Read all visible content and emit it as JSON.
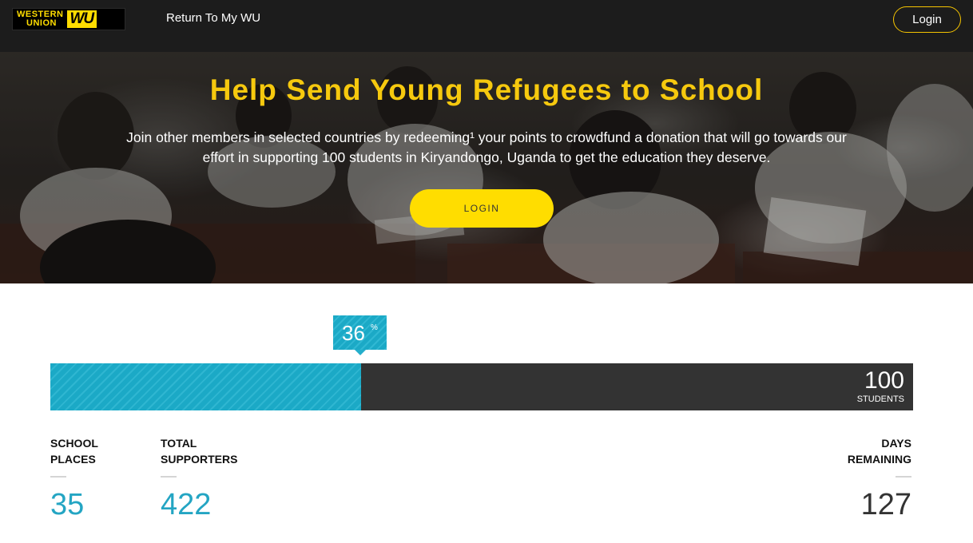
{
  "header": {
    "logo_words": [
      "WESTERN",
      "UNION"
    ],
    "logo_mark": "WU",
    "return_link": "Return To My WU",
    "login_button": "Login"
  },
  "hero": {
    "title": "Help Send Young Refugees to School",
    "text": "Join other members in selected countries by redeeming¹ your points to crowdfund a donation that will go towards our effort in supporting 100 students in Kiryandongo, Uganda to get the education they deserve.",
    "login_button": "LOGIN"
  },
  "progress": {
    "percent": 36,
    "percent_unit": "%",
    "goal": "100",
    "goal_unit": "STUDENTS",
    "fill_color": "#1ba9c6",
    "track_color": "#333333"
  },
  "stats": {
    "school_places": {
      "label_line1": "SCHOOL",
      "label_line2": "PLACES",
      "value": "35"
    },
    "total_supporters": {
      "label_line1": "TOTAL",
      "label_line2": "SUPPORTERS",
      "value": "422"
    },
    "days_remaining": {
      "label_line1": "DAYS",
      "label_line2": "REMAINING",
      "value": "127"
    }
  },
  "colors": {
    "brand_yellow": "#ffdd00",
    "title_yellow": "#f6c90e",
    "accent_blue": "#24a5c3",
    "topbar": "#1c1c1c"
  }
}
